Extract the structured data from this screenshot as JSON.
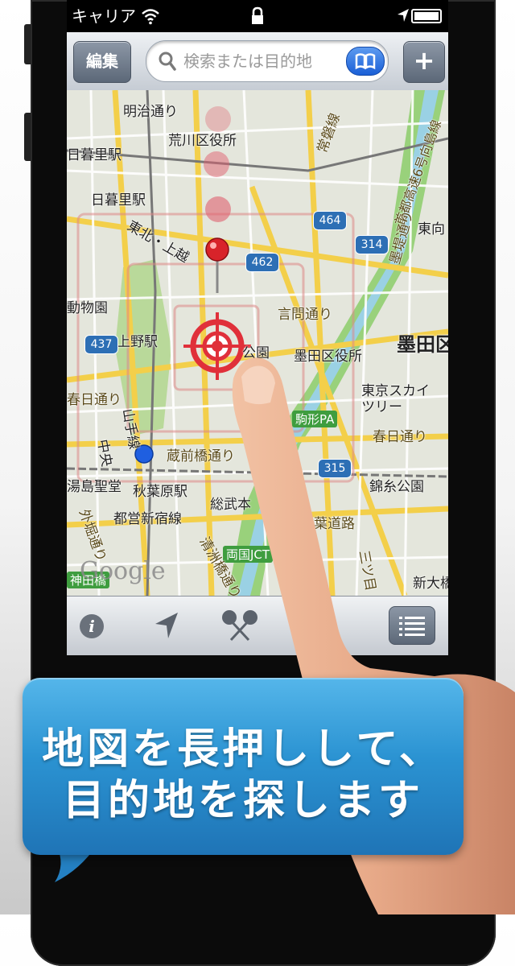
{
  "status_bar": {
    "carrier": "キャリア"
  },
  "nav_bar": {
    "edit_label": "編集",
    "search_placeholder": "検索または目的地",
    "add_label": "+"
  },
  "map": {
    "labels": {
      "meiji_dori": "明治通り",
      "arakawa_ku": "荒川区役所",
      "joban_sen": "常磐線",
      "shuto_6": "首都高速6号向島線",
      "nippori_eki_1": "日暮里駅",
      "nippori_eki_2": "日暮里駅",
      "tohoku_uesen": "東北・上越",
      "bokutei": "墨堤通り",
      "higashimuko": "東向",
      "dobutsuen": "動物園",
      "ueno_eki": "上野駅",
      "kotoi_dori": "言問通り",
      "sumida_ku": "墨田区",
      "koen": "公園",
      "sumida_kuyakusho": "墨田区役所",
      "tokyo_skytree": "東京スカイ\nツリー",
      "kasuga_dori_w": "春日通り",
      "kasuga_dori_e": "春日通り",
      "komagata_pa": "駒形PA",
      "yamanote_sen": "山手線",
      "chuo_sen": "中央",
      "kuramae": "蔵前橋通り",
      "yushima": "湯島聖堂",
      "akihabara": "秋葉原駅",
      "kinshi_koen": "錦糸公園",
      "toei_shinjuku": "都営新宿線",
      "sobu_sen": "総武本",
      "keiyo": "京葉道路",
      "ryogoku_jct": "両国JCT",
      "sotobori": "外堀通り",
      "kiyosu": "清洲橋通り",
      "kanda_bashi": "神田橋",
      "shin_ohashi": "新大橋",
      "mitsume": "三ツ目"
    },
    "shields": {
      "s464": "464",
      "s462": "462",
      "s314": "314",
      "s437": "437",
      "s315": "315"
    },
    "google": "Google"
  },
  "caption": {
    "line1": "地図を長押しして、",
    "line2": "目的地を探します"
  },
  "colors": {
    "caption_blue": "#2b93d2",
    "pin_red": "#d8232a",
    "pin_blue": "#1f5fe0",
    "road_yellow": "#f7d24a",
    "highway_green": "#7ec460"
  },
  "icons": {
    "wifi": "wifi-icon",
    "lock": "lock-icon",
    "location": "location-arrow-icon",
    "battery": "battery-icon",
    "search": "magnifier-icon",
    "bookmark": "book-icon",
    "info": "info-icon",
    "locate": "navigation-arrow-icon",
    "pins": "pins-icon",
    "list": "list-icon",
    "target": "crosshair-target-icon"
  }
}
